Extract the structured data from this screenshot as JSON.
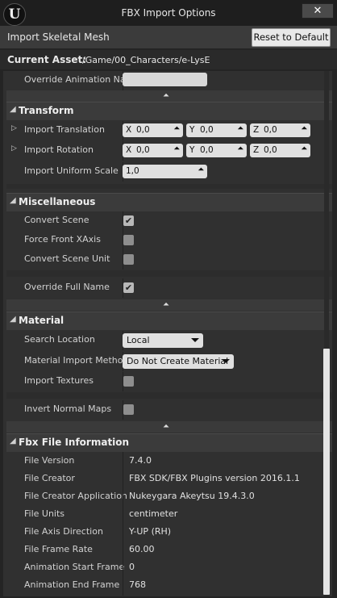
{
  "window": {
    "logo": "U",
    "title": "FBX Import Options",
    "close_label": "✕"
  },
  "import_bar": {
    "label": "Import Skeletal Mesh",
    "reset_label": "Reset to Default"
  },
  "asset": {
    "label": "Current Asset:",
    "path": "/Game/00_Characters/e-LysE"
  },
  "animation": {
    "override_name_label": "Override Animation Nam",
    "override_name_value": ""
  },
  "transform": {
    "title": "Transform",
    "translation": {
      "label": "Import Translation",
      "x": "0,0",
      "y": "0,0",
      "z": "0,0"
    },
    "rotation": {
      "label": "Import Rotation",
      "x": "0,0",
      "y": "0,0",
      "z": "0,0"
    },
    "uniform_scale": {
      "label": "Import Uniform Scale",
      "value": "1,0"
    },
    "axis_labels": {
      "x": "X",
      "y": "Y",
      "z": "Z"
    }
  },
  "misc": {
    "title": "Miscellaneous",
    "items": [
      {
        "label": "Convert Scene",
        "checked": true
      },
      {
        "label": "Force Front XAxis",
        "checked": false
      },
      {
        "label": "Convert Scene Unit",
        "checked": false
      },
      {
        "label": "Override Full Name",
        "checked": true
      }
    ]
  },
  "material": {
    "title": "Material",
    "search_location": {
      "label": "Search Location",
      "value": "Local"
    },
    "import_method": {
      "label": "Material Import Method",
      "value": "Do Not Create Material"
    },
    "import_textures": {
      "label": "Import Textures",
      "checked": false
    },
    "invert_normal_maps": {
      "label": "Invert Normal Maps",
      "checked": false
    }
  },
  "fbx_info": {
    "title": "Fbx File Information",
    "rows": [
      {
        "label": "File Version",
        "value": "7.4.0"
      },
      {
        "label": "File Creator",
        "value": "FBX SDK/FBX Plugins version 2016.1.1"
      },
      {
        "label": "File Creator Application",
        "value": "Nukeygara Akeytsu 19.4.3.0"
      },
      {
        "label": "File Units",
        "value": "centimeter"
      },
      {
        "label": "File Axis Direction",
        "value": "Y-UP (RH)"
      },
      {
        "label": "File Frame Rate",
        "value": "60.00"
      },
      {
        "label": "Animation Start Frame",
        "value": "0"
      },
      {
        "label": "Animation End Frame",
        "value": "768"
      }
    ]
  },
  "glyphs": {
    "section_caret": "◢",
    "collapse": "⏶",
    "expand": "▷",
    "check": "✔"
  }
}
